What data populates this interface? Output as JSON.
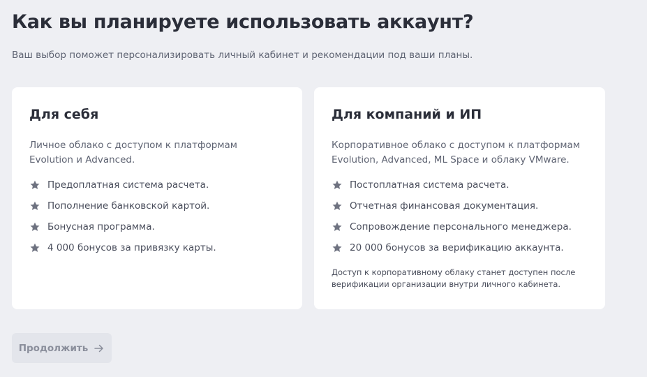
{
  "header": {
    "title": "Как вы планируете использовать аккаунт?",
    "subtitle": "Ваш выбор поможет персонализировать личный кабинет и рекомендации под ваши планы."
  },
  "cards": [
    {
      "title": "Для себя",
      "description_line1": "Личное облако с доступом к платформам",
      "description_line2": "Evolution и Advanced.",
      "features": [
        "Предоплатная система расчета.",
        "Пополнение банковской картой.",
        "Бонусная программа.",
        "4 000 бонусов за привязку карты."
      ]
    },
    {
      "title": "Для компаний и ИП",
      "description_line1": "Корпоративное облако с доступом к платформам",
      "description_line2": "Evolution, Advanced, ML Space и облаку VMware.",
      "features": [
        "Постоплатная система расчета.",
        "Отчетная финансовая документация.",
        "Сопровождение персонального менеджера.",
        "20 000 бонусов за верификацию аккаунта."
      ],
      "note_line1": "Доступ к корпоративному облаку станет доступен после",
      "note_line2": "верификации организации внутри личного кабинета."
    }
  ],
  "actions": {
    "continue_label": "Продолжить",
    "continue_icon": "arrow-right-icon"
  },
  "icons": {
    "feature_bullet": "star-icon"
  },
  "colors": {
    "background": "#eeeff3",
    "card": "#ffffff",
    "star": "#6e7280",
    "button_bg": "#e3e5eb",
    "button_text": "#8a8e9b"
  }
}
